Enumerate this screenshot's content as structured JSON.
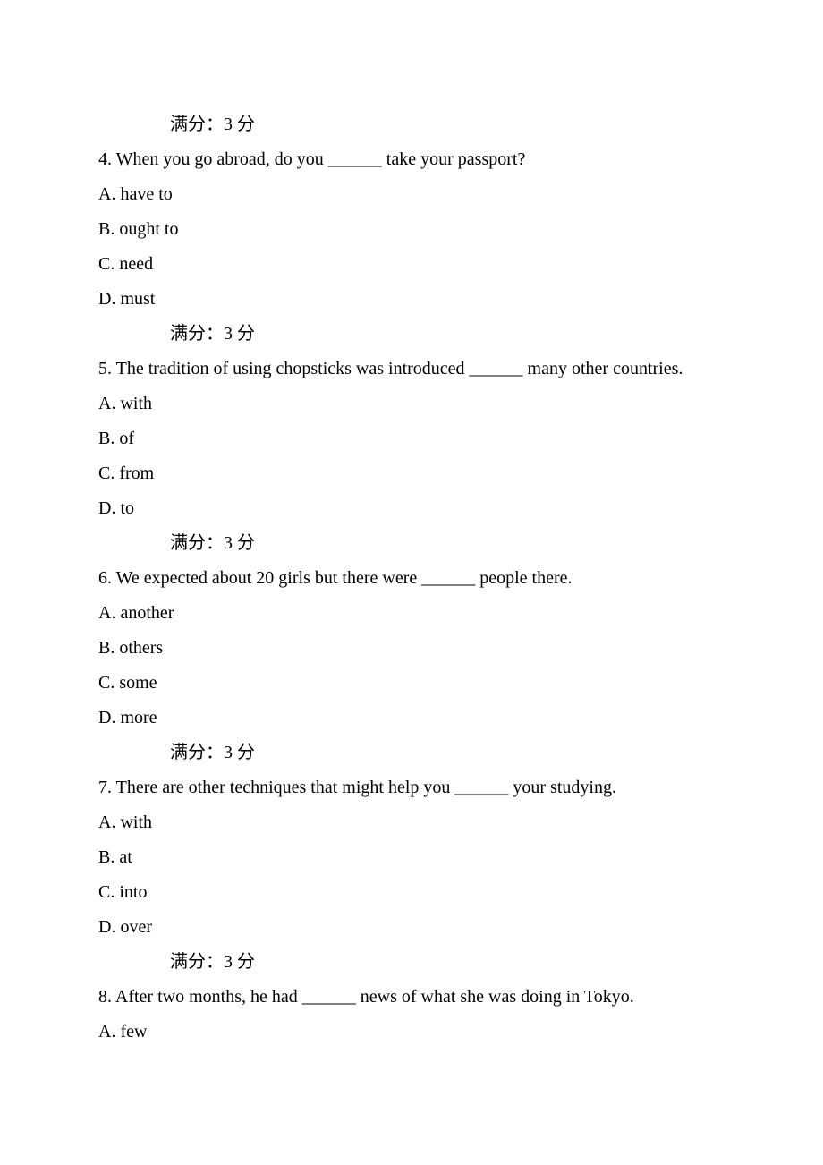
{
  "scoreLabel": "满分：3  分",
  "q3": {
    "score": "满分：3  分"
  },
  "q4": {
    "text": "4.  When you go abroad, do you ______ take your passport?",
    "optA": "A. have to",
    "optB": "B. ought to",
    "optC": "C. need",
    "optD": "D. must",
    "score": "满分：3  分"
  },
  "q5": {
    "text": "5.  The tradition of using chopsticks was introduced ______ many other countries.",
    "optA": "A. with",
    "optB": "B. of",
    "optC": "C. from",
    "optD": "D. to",
    "score": "满分：3  分"
  },
  "q6": {
    "text": "6.  We expected about 20 girls but there were ______ people there.",
    "optA": "A. another",
    "optB": "B. others",
    "optC": "C. some",
    "optD": "D. more",
    "score": "满分：3  分"
  },
  "q7": {
    "text": "7.  There are other techniques that might help you ______ your studying.",
    "optA": "A. with",
    "optB": "B. at",
    "optC": "C. into",
    "optD": "D. over",
    "score": "满分：3  分"
  },
  "q8": {
    "text": "8.  After two months, he had ______ news of what she was doing in Tokyo.",
    "optA": "A.  few"
  }
}
